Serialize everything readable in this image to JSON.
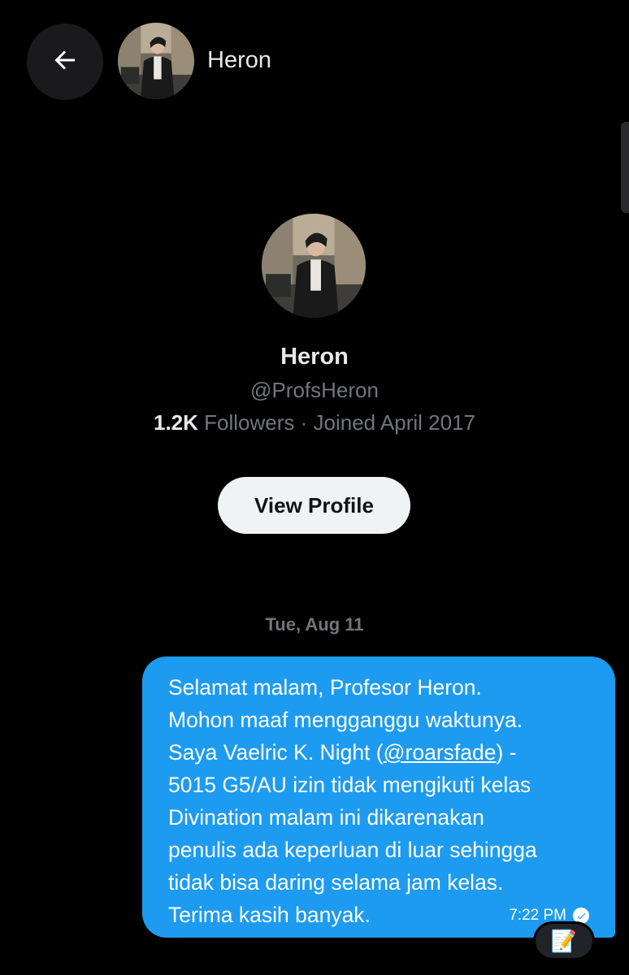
{
  "header": {
    "back_icon": "arrow-left-icon",
    "name": "Heron"
  },
  "profile": {
    "name": "Heron",
    "handle": "@ProfsHeron",
    "followers_count": "1.2K",
    "followers_label": "Followers",
    "separator": " · ",
    "joined": "Joined April 2017",
    "view_profile_label": "View Profile"
  },
  "conversation": {
    "date": "Tue, Aug 11",
    "messages": [
      {
        "text_before": "Selamat malam, Profesor Heron.\nMohon maaf mengganggu waktunya.\nSaya Vaelric K. Night (",
        "mention": "@roarsfade",
        "text_after": ") -\n5015 G5/AU izin tidak mengikuti kelas\nDivination malam ini dikarenakan\npenulis ada keperluan di luar sehingga\ntidak bisa daring selama jam kelas.\nTerima kasih banyak.",
        "time": "7:22 PM",
        "status_icon": "read-check-icon",
        "reaction": "📝"
      }
    ]
  },
  "colors": {
    "background": "#000000",
    "bubble": "#1d9bf0",
    "muted_text": "#71767b",
    "button_bg": "#eff3f4"
  }
}
